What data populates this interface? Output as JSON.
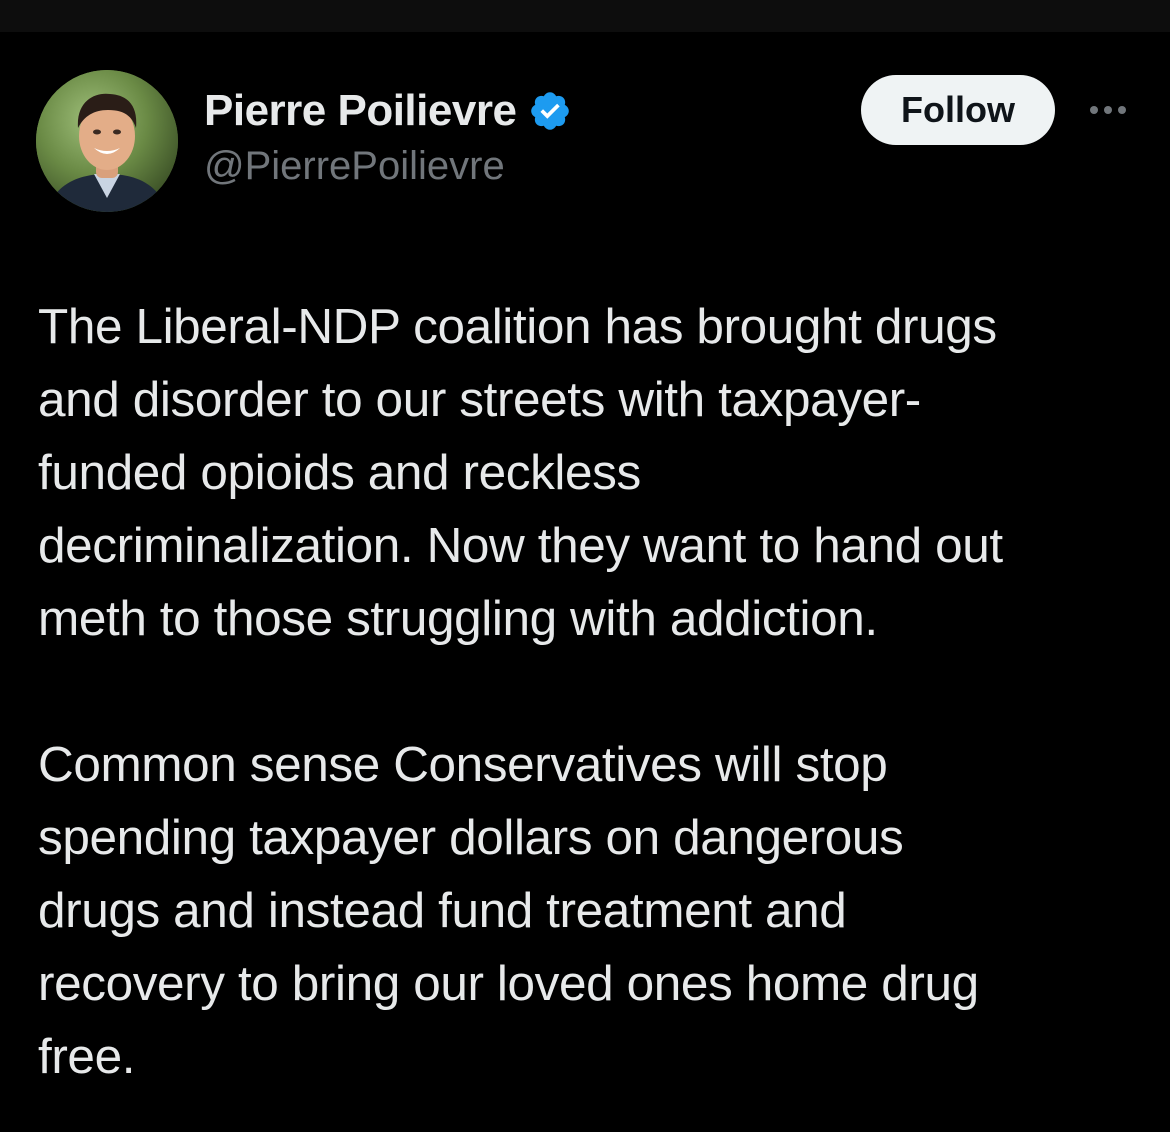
{
  "author": {
    "display_name": "Pierre Poilievre",
    "handle": "@PierrePoilievre",
    "verified": true,
    "verified_icon": "verified-badge-icon",
    "avatar_icon": "profile-photo"
  },
  "actions": {
    "follow_label": "Follow",
    "more_icon": "more-horizontal-icon"
  },
  "tweet": {
    "paragraphs": [
      {
        "lines": [
          "The Liberal-NDP coalition has brought drugs",
          "and disorder to our streets with taxpayer-",
          "funded opioids and reckless",
          "decriminalization. Now they want to hand out",
          "meth to those struggling with addiction."
        ]
      },
      {
        "lines": [
          "Common sense Conservatives will stop",
          "spending taxpayer dollars on dangerous",
          "drugs and instead fund treatment and",
          "recovery to bring our loved ones home drug",
          "free."
        ]
      }
    ]
  },
  "colors": {
    "background": "#000000",
    "text_primary": "#e7e9ea",
    "text_secondary": "#71767b",
    "verified_blue": "#1d9bf0",
    "button_bg": "#eff3f4",
    "button_text": "#0f1419"
  }
}
